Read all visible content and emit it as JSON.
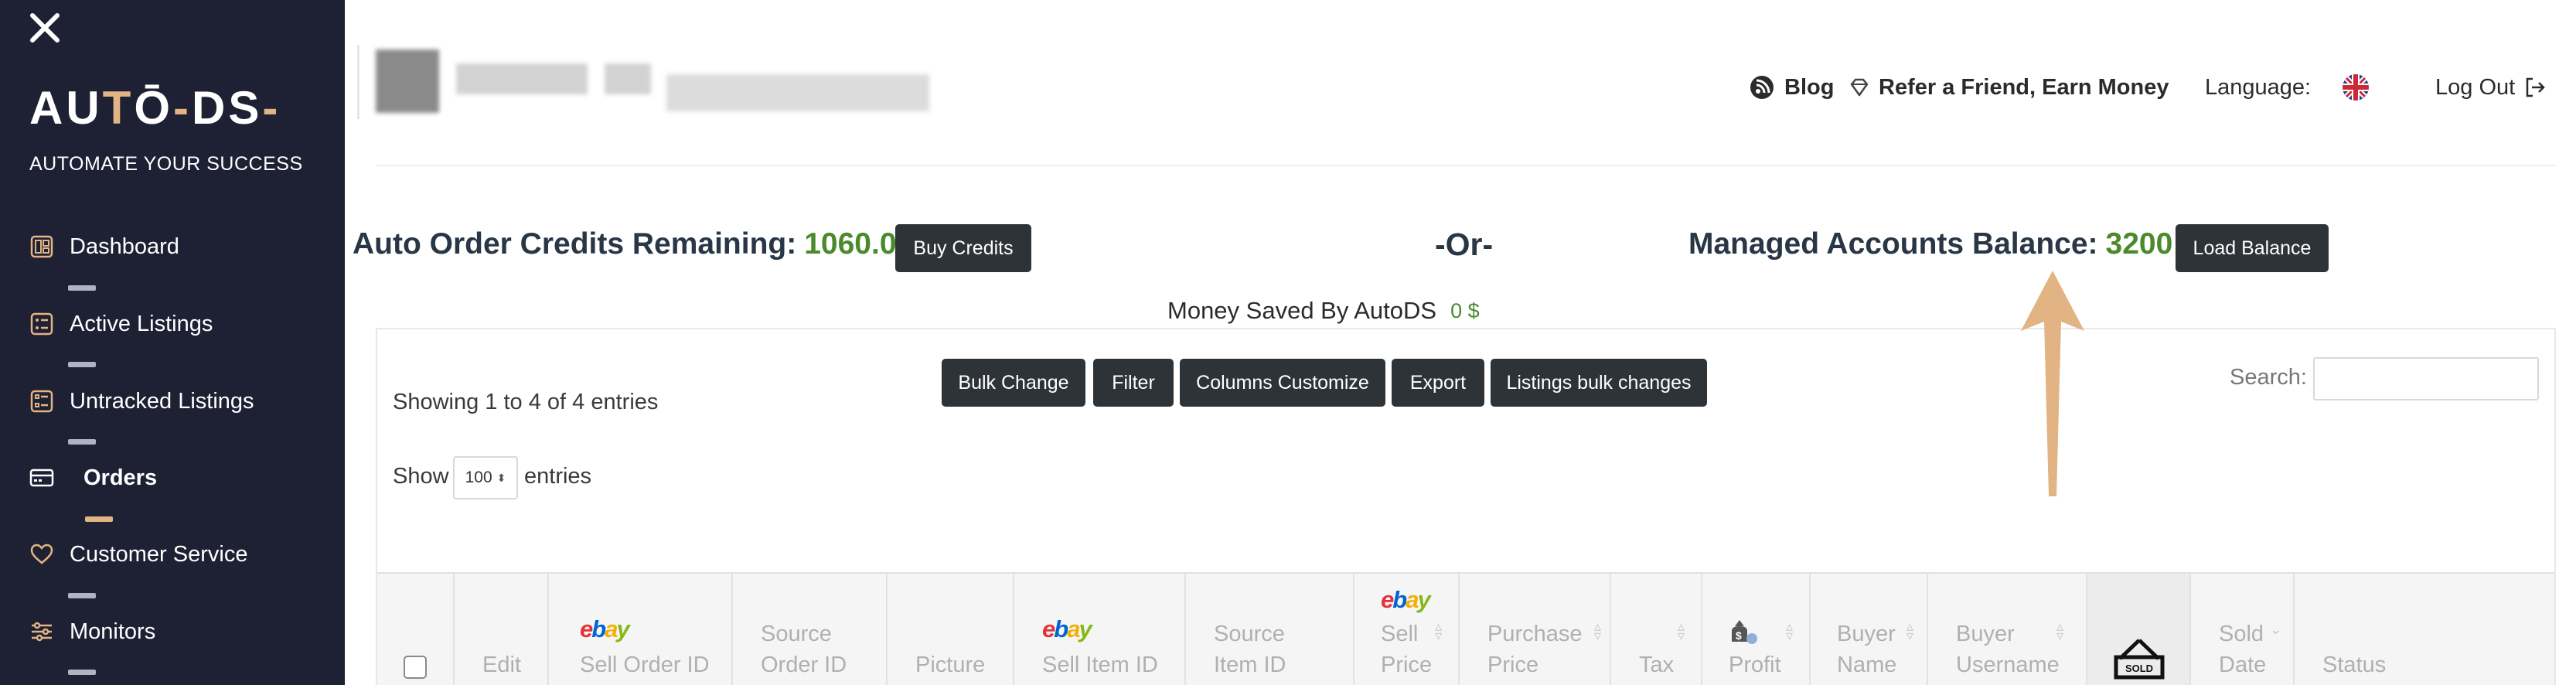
{
  "sidebar": {
    "close_label": "close",
    "logo": {
      "part1": "AU",
      "part2": "T",
      "part3": "Ō",
      "part4": "-",
      "part5": "DS",
      "part6": "-"
    },
    "tagline": "AUTOMATE YOUR SUCCESS",
    "items": [
      {
        "label": "Dashboard",
        "icon": "dashboard-icon",
        "active": false
      },
      {
        "label": "Active Listings",
        "icon": "listings-icon",
        "active": false
      },
      {
        "label": "Untracked Listings",
        "icon": "untracked-icon",
        "active": false
      },
      {
        "label": "Orders",
        "icon": "orders-icon",
        "active": true
      },
      {
        "label": "Customer Service",
        "icon": "heart-icon",
        "active": false
      },
      {
        "label": "Monitors",
        "icon": "sliders-icon",
        "active": false
      }
    ]
  },
  "header": {
    "blog": "Blog",
    "refer": "Refer a Friend, Earn Money",
    "language_label": "Language:",
    "logout": "Log Out"
  },
  "credits": {
    "auto_order_label": "Auto Order Credits Remaining:",
    "auto_order_value": "1060.0",
    "buy_button": "Buy Credits",
    "or_text": "-Or-",
    "managed_label": "Managed Accounts Balance:",
    "managed_value": "3200",
    "load_button": "Load Balance",
    "saved_label": "Money Saved By AutoDS",
    "saved_value": "0 $"
  },
  "table_controls": {
    "buttons": [
      "Bulk Change",
      "Filter",
      "Columns Customize",
      "Export",
      "Listings bulk changes"
    ],
    "showing": "Showing 1 to 4 of 4 entries",
    "show_label": "Show",
    "show_value": "100",
    "entries_label": "entries",
    "search_label": "Search:",
    "search_value": ""
  },
  "columns": [
    {
      "id": "edit",
      "lines": [
        "Edit"
      ]
    },
    {
      "id": "sell-order-id",
      "lines": [
        "Sell Order ID"
      ]
    },
    {
      "id": "source-order-id",
      "lines": [
        "Source",
        "Order ID"
      ]
    },
    {
      "id": "picture",
      "lines": [
        "Picture"
      ]
    },
    {
      "id": "sell-item-id",
      "lines": [
        "Sell Item ID"
      ]
    },
    {
      "id": "source-item-id",
      "lines": [
        "Source",
        "Item ID"
      ]
    },
    {
      "id": "sell-price",
      "lines": [
        "Sell",
        "Price"
      ]
    },
    {
      "id": "purchase-price",
      "lines": [
        "Purchase",
        "Price"
      ]
    },
    {
      "id": "tax",
      "lines": [
        "Tax"
      ]
    },
    {
      "id": "profit",
      "lines": [
        "Profit"
      ]
    },
    {
      "id": "buyer-name",
      "lines": [
        "Buyer",
        "Name"
      ]
    },
    {
      "id": "buyer-username",
      "lines": [
        "Buyer",
        "Username"
      ]
    },
    {
      "id": "sold-icon-col",
      "lines": [
        "SOLD"
      ]
    },
    {
      "id": "sold-date",
      "lines": [
        "Sold",
        "Date"
      ]
    },
    {
      "id": "status",
      "lines": [
        "Status"
      ]
    }
  ],
  "ebay_logo": {
    "e": "e",
    "b": "b",
    "a": "a",
    "y": "y"
  },
  "colors": {
    "sidebar_bg": "#1e2034",
    "accent": "#e2b483",
    "positive": "#4a8a2b",
    "button_dark": "#2e3338",
    "annotation_arrow": "#e2b483"
  }
}
